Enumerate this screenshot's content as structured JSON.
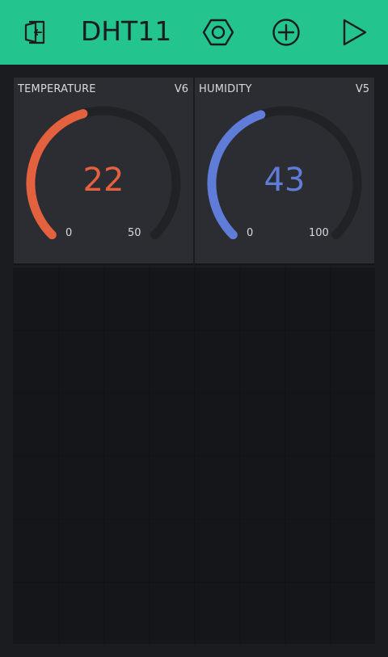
{
  "app": {
    "title": "DHT11"
  },
  "toolbar": {
    "back_icon": "exit-icon",
    "settings_icon": "hexagon-settings-icon",
    "add_icon": "plus-circle-icon",
    "play_icon": "play-icon",
    "accent": "#23c48e"
  },
  "widgets": [
    {
      "label": "TEMPERATURE",
      "pin": "V6",
      "value": "22",
      "min": "0",
      "max": "50",
      "fraction": 0.44,
      "color": "#e3613f"
    },
    {
      "label": "HUMIDITY",
      "pin": "V5",
      "value": "43",
      "min": "0",
      "max": "100",
      "fraction": 0.43,
      "color": "#5f7cd8"
    }
  ]
}
